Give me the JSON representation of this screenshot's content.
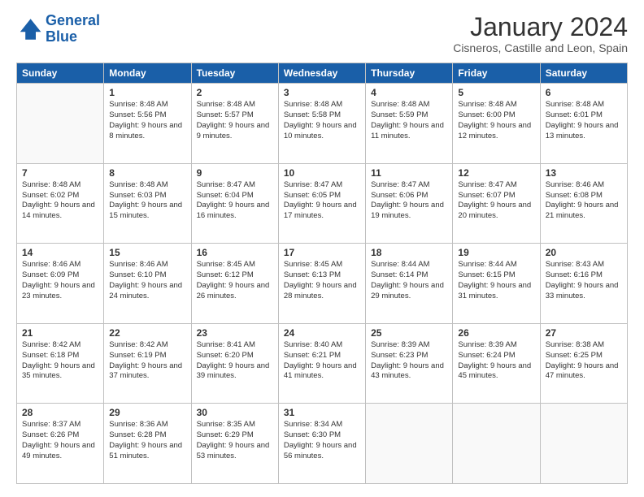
{
  "logo": {
    "line1": "General",
    "line2": "Blue"
  },
  "title": "January 2024",
  "location": "Cisneros, Castille and Leon, Spain",
  "weekdays": [
    "Sunday",
    "Monday",
    "Tuesday",
    "Wednesday",
    "Thursday",
    "Friday",
    "Saturday"
  ],
  "weeks": [
    [
      {
        "day": "",
        "sunrise": "",
        "sunset": "",
        "daylight": ""
      },
      {
        "day": "1",
        "sunrise": "Sunrise: 8:48 AM",
        "sunset": "Sunset: 5:56 PM",
        "daylight": "Daylight: 9 hours and 8 minutes."
      },
      {
        "day": "2",
        "sunrise": "Sunrise: 8:48 AM",
        "sunset": "Sunset: 5:57 PM",
        "daylight": "Daylight: 9 hours and 9 minutes."
      },
      {
        "day": "3",
        "sunrise": "Sunrise: 8:48 AM",
        "sunset": "Sunset: 5:58 PM",
        "daylight": "Daylight: 9 hours and 10 minutes."
      },
      {
        "day": "4",
        "sunrise": "Sunrise: 8:48 AM",
        "sunset": "Sunset: 5:59 PM",
        "daylight": "Daylight: 9 hours and 11 minutes."
      },
      {
        "day": "5",
        "sunrise": "Sunrise: 8:48 AM",
        "sunset": "Sunset: 6:00 PM",
        "daylight": "Daylight: 9 hours and 12 minutes."
      },
      {
        "day": "6",
        "sunrise": "Sunrise: 8:48 AM",
        "sunset": "Sunset: 6:01 PM",
        "daylight": "Daylight: 9 hours and 13 minutes."
      }
    ],
    [
      {
        "day": "7",
        "sunrise": "Sunrise: 8:48 AM",
        "sunset": "Sunset: 6:02 PM",
        "daylight": "Daylight: 9 hours and 14 minutes."
      },
      {
        "day": "8",
        "sunrise": "Sunrise: 8:48 AM",
        "sunset": "Sunset: 6:03 PM",
        "daylight": "Daylight: 9 hours and 15 minutes."
      },
      {
        "day": "9",
        "sunrise": "Sunrise: 8:47 AM",
        "sunset": "Sunset: 6:04 PM",
        "daylight": "Daylight: 9 hours and 16 minutes."
      },
      {
        "day": "10",
        "sunrise": "Sunrise: 8:47 AM",
        "sunset": "Sunset: 6:05 PM",
        "daylight": "Daylight: 9 hours and 17 minutes."
      },
      {
        "day": "11",
        "sunrise": "Sunrise: 8:47 AM",
        "sunset": "Sunset: 6:06 PM",
        "daylight": "Daylight: 9 hours and 19 minutes."
      },
      {
        "day": "12",
        "sunrise": "Sunrise: 8:47 AM",
        "sunset": "Sunset: 6:07 PM",
        "daylight": "Daylight: 9 hours and 20 minutes."
      },
      {
        "day": "13",
        "sunrise": "Sunrise: 8:46 AM",
        "sunset": "Sunset: 6:08 PM",
        "daylight": "Daylight: 9 hours and 21 minutes."
      }
    ],
    [
      {
        "day": "14",
        "sunrise": "Sunrise: 8:46 AM",
        "sunset": "Sunset: 6:09 PM",
        "daylight": "Daylight: 9 hours and 23 minutes."
      },
      {
        "day": "15",
        "sunrise": "Sunrise: 8:46 AM",
        "sunset": "Sunset: 6:10 PM",
        "daylight": "Daylight: 9 hours and 24 minutes."
      },
      {
        "day": "16",
        "sunrise": "Sunrise: 8:45 AM",
        "sunset": "Sunset: 6:12 PM",
        "daylight": "Daylight: 9 hours and 26 minutes."
      },
      {
        "day": "17",
        "sunrise": "Sunrise: 8:45 AM",
        "sunset": "Sunset: 6:13 PM",
        "daylight": "Daylight: 9 hours and 28 minutes."
      },
      {
        "day": "18",
        "sunrise": "Sunrise: 8:44 AM",
        "sunset": "Sunset: 6:14 PM",
        "daylight": "Daylight: 9 hours and 29 minutes."
      },
      {
        "day": "19",
        "sunrise": "Sunrise: 8:44 AM",
        "sunset": "Sunset: 6:15 PM",
        "daylight": "Daylight: 9 hours and 31 minutes."
      },
      {
        "day": "20",
        "sunrise": "Sunrise: 8:43 AM",
        "sunset": "Sunset: 6:16 PM",
        "daylight": "Daylight: 9 hours and 33 minutes."
      }
    ],
    [
      {
        "day": "21",
        "sunrise": "Sunrise: 8:42 AM",
        "sunset": "Sunset: 6:18 PM",
        "daylight": "Daylight: 9 hours and 35 minutes."
      },
      {
        "day": "22",
        "sunrise": "Sunrise: 8:42 AM",
        "sunset": "Sunset: 6:19 PM",
        "daylight": "Daylight: 9 hours and 37 minutes."
      },
      {
        "day": "23",
        "sunrise": "Sunrise: 8:41 AM",
        "sunset": "Sunset: 6:20 PM",
        "daylight": "Daylight: 9 hours and 39 minutes."
      },
      {
        "day": "24",
        "sunrise": "Sunrise: 8:40 AM",
        "sunset": "Sunset: 6:21 PM",
        "daylight": "Daylight: 9 hours and 41 minutes."
      },
      {
        "day": "25",
        "sunrise": "Sunrise: 8:39 AM",
        "sunset": "Sunset: 6:23 PM",
        "daylight": "Daylight: 9 hours and 43 minutes."
      },
      {
        "day": "26",
        "sunrise": "Sunrise: 8:39 AM",
        "sunset": "Sunset: 6:24 PM",
        "daylight": "Daylight: 9 hours and 45 minutes."
      },
      {
        "day": "27",
        "sunrise": "Sunrise: 8:38 AM",
        "sunset": "Sunset: 6:25 PM",
        "daylight": "Daylight: 9 hours and 47 minutes."
      }
    ],
    [
      {
        "day": "28",
        "sunrise": "Sunrise: 8:37 AM",
        "sunset": "Sunset: 6:26 PM",
        "daylight": "Daylight: 9 hours and 49 minutes."
      },
      {
        "day": "29",
        "sunrise": "Sunrise: 8:36 AM",
        "sunset": "Sunset: 6:28 PM",
        "daylight": "Daylight: 9 hours and 51 minutes."
      },
      {
        "day": "30",
        "sunrise": "Sunrise: 8:35 AM",
        "sunset": "Sunset: 6:29 PM",
        "daylight": "Daylight: 9 hours and 53 minutes."
      },
      {
        "day": "31",
        "sunrise": "Sunrise: 8:34 AM",
        "sunset": "Sunset: 6:30 PM",
        "daylight": "Daylight: 9 hours and 56 minutes."
      },
      {
        "day": "",
        "sunrise": "",
        "sunset": "",
        "daylight": ""
      },
      {
        "day": "",
        "sunrise": "",
        "sunset": "",
        "daylight": ""
      },
      {
        "day": "",
        "sunrise": "",
        "sunset": "",
        "daylight": ""
      }
    ]
  ]
}
